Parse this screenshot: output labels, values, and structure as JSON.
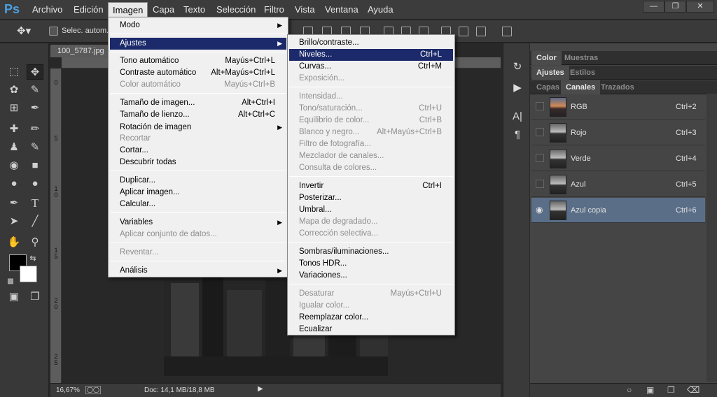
{
  "app": {
    "logo": "Ps"
  },
  "menubar": [
    "Archivo",
    "Edición",
    "Imagen",
    "Capa",
    "Texto",
    "Selección",
    "Filtro",
    "Vista",
    "Ventana",
    "Ayuda"
  ],
  "optionsbar": {
    "auto_select_label": "Selec. autom.:"
  },
  "document": {
    "tab": "100_5787.jpg",
    "zoom": "16,67%",
    "doc_size": "Doc: 14,1 MB/18,8 MB",
    "ruler_left": [
      "0",
      "5",
      "1\n0",
      "1\n5",
      "2\n0",
      "2\n5"
    ]
  },
  "imagen_menu": {
    "items": [
      {
        "label": "Modo",
        "submenu": true
      },
      {
        "label": "Ajustes",
        "submenu": true,
        "highlighted": true
      },
      {
        "label": "Tono automático",
        "shortcut": "Mayús+Ctrl+L"
      },
      {
        "label": "Contraste automático",
        "shortcut": "Alt+Mayús+Ctrl+L"
      },
      {
        "label": "Color automático",
        "shortcut": "Mayús+Ctrl+B",
        "disabled": true
      },
      {
        "label": "Tamaño de imagen...",
        "shortcut": "Alt+Ctrl+I"
      },
      {
        "label": "Tamaño de lienzo...",
        "shortcut": "Alt+Ctrl+C"
      },
      {
        "label": "Rotación de imagen",
        "submenu": true
      },
      {
        "label": "Recortar",
        "disabled": true
      },
      {
        "label": "Cortar..."
      },
      {
        "label": "Descubrir todas"
      },
      {
        "label": "Duplicar..."
      },
      {
        "label": "Aplicar imagen..."
      },
      {
        "label": "Calcular..."
      },
      {
        "label": "Variables",
        "submenu": true
      },
      {
        "label": "Aplicar conjunto de datos...",
        "disabled": true
      },
      {
        "label": "Reventar...",
        "disabled": true
      },
      {
        "label": "Análisis",
        "submenu": true
      }
    ]
  },
  "ajustes_menu": {
    "items": [
      {
        "label": "Brillo/contraste..."
      },
      {
        "label": "Niveles...",
        "shortcut": "Ctrl+L",
        "highlighted": true
      },
      {
        "label": "Curvas...",
        "shortcut": "Ctrl+M"
      },
      {
        "label": "Exposición...",
        "disabled": true
      },
      {
        "label": "Intensidad...",
        "disabled": true
      },
      {
        "label": "Tono/saturación...",
        "shortcut": "Ctrl+U",
        "disabled": true
      },
      {
        "label": "Equilibrio de color...",
        "shortcut": "Ctrl+B",
        "disabled": true
      },
      {
        "label": "Blanco y negro...",
        "shortcut": "Alt+Mayús+Ctrl+B",
        "disabled": true
      },
      {
        "label": "Filtro de fotografía...",
        "disabled": true
      },
      {
        "label": "Mezclador de canales...",
        "disabled": true
      },
      {
        "label": "Consulta de colores...",
        "disabled": true
      },
      {
        "label": "Invertir",
        "shortcut": "Ctrl+I"
      },
      {
        "label": "Posterizar..."
      },
      {
        "label": "Umbral..."
      },
      {
        "label": "Mapa de degradado...",
        "disabled": true
      },
      {
        "label": "Corrección selectiva...",
        "disabled": true
      },
      {
        "label": "Sombras/iluminaciones..."
      },
      {
        "label": "Tonos HDR..."
      },
      {
        "label": "Variaciones..."
      },
      {
        "label": "Desaturar",
        "shortcut": "Mayús+Ctrl+U",
        "disabled": true
      },
      {
        "label": "Igualar color...",
        "disabled": true
      },
      {
        "label": "Reemplazar color..."
      },
      {
        "label": "Ecualizar"
      }
    ]
  },
  "panels": {
    "group1": [
      "Color",
      "Muestras"
    ],
    "group2": [
      "Ajustes",
      "Estilos"
    ],
    "group3": [
      "Capas",
      "Canales",
      "Trazados"
    ],
    "channels": [
      {
        "name": "RGB",
        "shortcut": "Ctrl+2"
      },
      {
        "name": "Rojo",
        "shortcut": "Ctrl+3"
      },
      {
        "name": "Verde",
        "shortcut": "Ctrl+4"
      },
      {
        "name": "Azul",
        "shortcut": "Ctrl+5"
      },
      {
        "name": "Azul copia",
        "shortcut": "Ctrl+6",
        "selected": true
      }
    ]
  }
}
